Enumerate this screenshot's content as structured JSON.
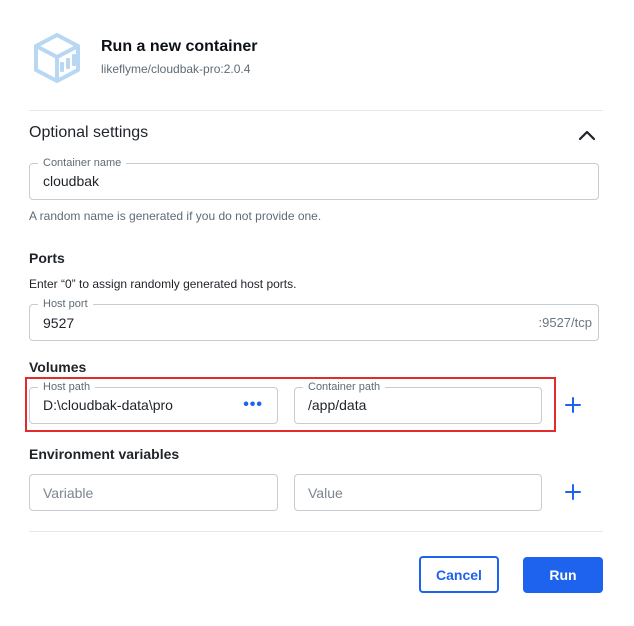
{
  "header": {
    "title": "Run a new container",
    "image": "likeflyme/cloudbak-pro:2.0.4",
    "icon": "container-cube-icon"
  },
  "optional_settings": {
    "title": "Optional settings",
    "collapse_icon": "chevron-up-icon",
    "container_name": {
      "label": "Container name",
      "value": "cloudbak",
      "helper": "A random name is generated if you do not provide one."
    }
  },
  "ports": {
    "title": "Ports",
    "description": "Enter “0” to assign randomly generated host ports.",
    "host_port": {
      "label": "Host port",
      "value": "9527",
      "suffix": ":9527/tcp"
    }
  },
  "volumes": {
    "title": "Volumes",
    "host_path": {
      "label": "Host path",
      "value": "D:\\cloudbak-data\\pro",
      "browse_icon": "ellipsis-icon",
      "browse_label": "•••"
    },
    "container_path": {
      "label": "Container path",
      "value": "/app/data"
    },
    "add_icon": "plus-icon"
  },
  "env": {
    "title": "Environment variables",
    "variable_placeholder": "Variable",
    "value_placeholder": "Value",
    "add_icon": "plus-icon"
  },
  "actions": {
    "cancel_label": "Cancel",
    "run_label": "Run"
  },
  "colors": {
    "accent": "#1d63ed",
    "highlight_border": "#e02c2c",
    "icon_light_blue": "#a9cff0"
  }
}
